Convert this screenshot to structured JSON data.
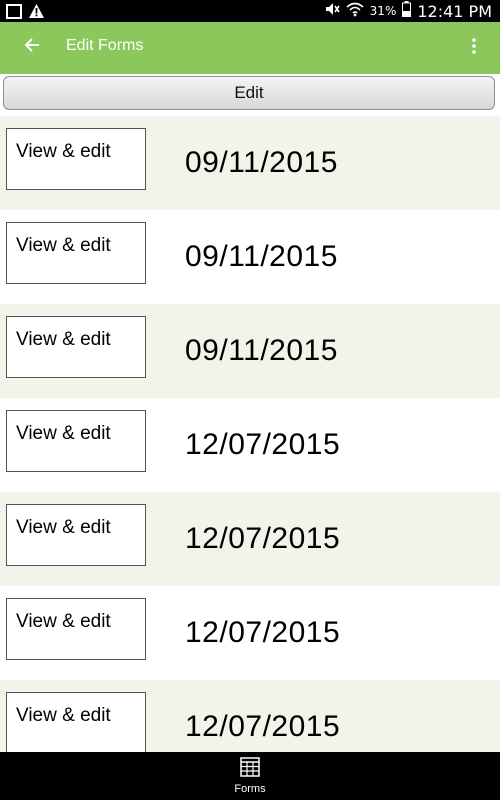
{
  "status_bar": {
    "battery_percent": "31%",
    "time": "12:41 PM",
    "icons": [
      "notification-icon",
      "warning-icon",
      "mute-icon",
      "wifi-icon",
      "battery-icon"
    ]
  },
  "app_bar": {
    "title": "Edit Forms",
    "back_icon": "arrow-back-icon",
    "menu_icon": "more-vert-icon",
    "color": "#8bc75a"
  },
  "edit_button": {
    "label": "Edit"
  },
  "rows": [
    {
      "button_label": "View & edit",
      "date": "09/11/2015"
    },
    {
      "button_label": "View & edit",
      "date": "09/11/2015"
    },
    {
      "button_label": "View & edit",
      "date": "09/11/2015"
    },
    {
      "button_label": "View & edit",
      "date": "12/07/2015"
    },
    {
      "button_label": "View & edit",
      "date": "12/07/2015"
    },
    {
      "button_label": "View & edit",
      "date": "12/07/2015"
    },
    {
      "button_label": "View & edit",
      "date": "12/07/2015"
    }
  ],
  "bottom_nav": {
    "forms_label": "Forms",
    "forms_icon": "grid-form-icon"
  }
}
